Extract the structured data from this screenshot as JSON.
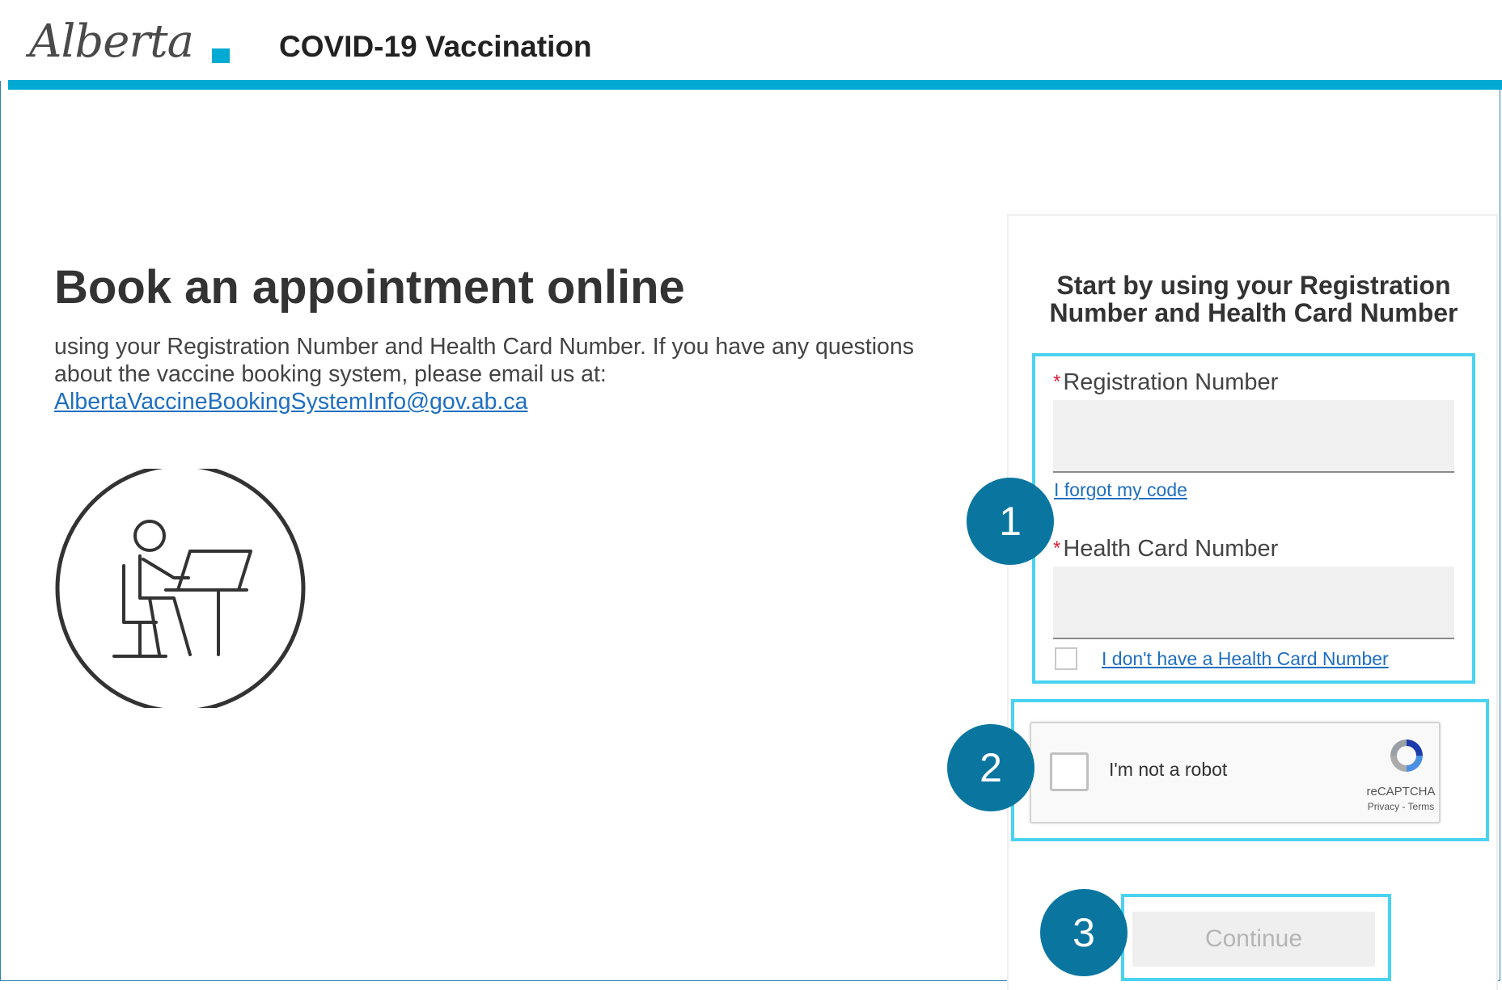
{
  "header": {
    "logo_text": "Alberta",
    "title": "COVID-19 Vaccination"
  },
  "main": {
    "heading": "Book an appointment online",
    "intro": "using your Registration Number and Health Card Number. If you have any questions about the vaccine booking system, please email us at:",
    "email": "AlbertaVaccineBookingSystemInfo@gov.ab.ca"
  },
  "form": {
    "title": "Start by using your Registration Number and Health Card Number",
    "registration_label": "Registration Number",
    "registration_value": "",
    "forgot_link": "I forgot my code",
    "health_card_label": "Health Card Number",
    "health_card_value": "",
    "no_health_card_link": "I don't have a Health Card Number",
    "required_mark": "*"
  },
  "recaptcha": {
    "label": "I'm not a robot",
    "brand": "reCAPTCHA",
    "links": "Privacy - Terms"
  },
  "continue_label": "Continue",
  "badges": [
    "1",
    "2",
    "3"
  ],
  "colors": {
    "accent": "#00aad2",
    "highlight": "#49d3f0",
    "badge": "#0a76a0",
    "link": "#1f6fbf",
    "required": "#d6203a"
  }
}
